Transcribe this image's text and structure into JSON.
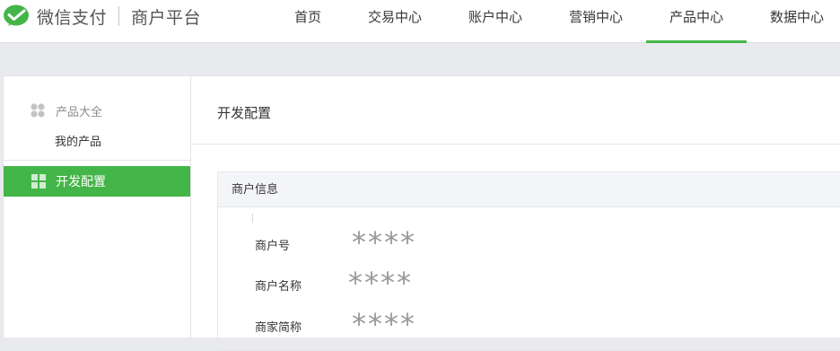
{
  "header": {
    "brand": "微信支付",
    "platform": "商户平台",
    "accent_color": "#44b549",
    "nav": [
      {
        "label": "首页",
        "active": false
      },
      {
        "label": "交易中心",
        "active": false
      },
      {
        "label": "账户中心",
        "active": false
      },
      {
        "label": "营销中心",
        "active": false
      },
      {
        "label": "产品中心",
        "active": true
      },
      {
        "label": "数据中心",
        "active": false
      }
    ]
  },
  "sidebar": {
    "group_label": "产品大全",
    "group_icon": "apps-icon",
    "link_label": "我的产品",
    "active_label": "开发配置",
    "active_icon": "grid-icon"
  },
  "main": {
    "title": "开发配置",
    "section": {
      "header": "商户信息",
      "rows": [
        {
          "label": "商户号",
          "value": "****"
        },
        {
          "label": "商户名称",
          "value": "****"
        },
        {
          "label": "商家简称",
          "value": "****"
        }
      ]
    }
  }
}
